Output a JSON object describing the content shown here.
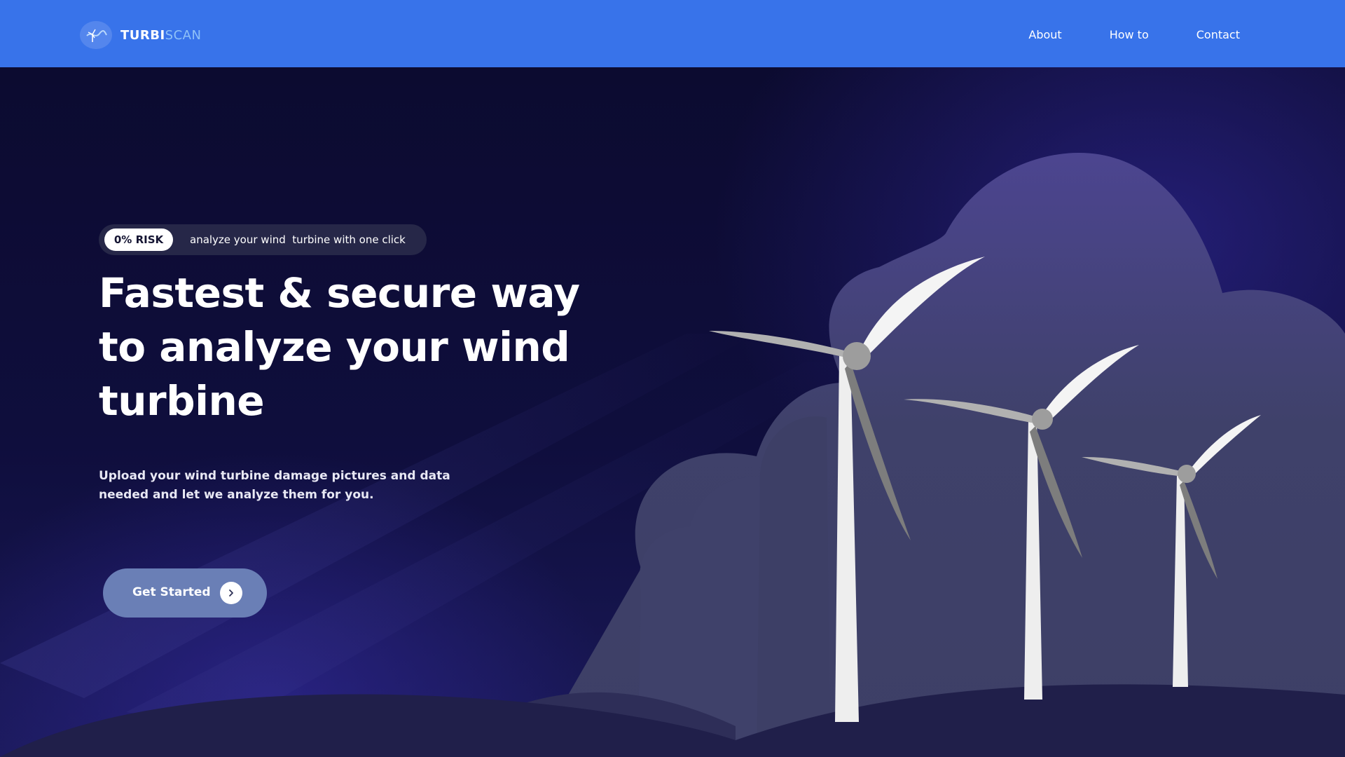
{
  "header": {
    "brand_primary": "TURBI",
    "brand_secondary": "SCAN",
    "logo_icon": "wind-turbine-icon",
    "nav": [
      "About",
      "How to",
      "Contact"
    ]
  },
  "hero": {
    "badge": "0% RISK",
    "tagline": "analyze your wind  turbine with one click",
    "title": "Fastest & secure way to analyze your wind turbine",
    "subtitle": "Upload your wind turbine damage pictures and data needed and let we analyze them for you.",
    "cta_label": "Get Started",
    "cta_icon": "chevron-right-icon"
  },
  "colors": {
    "header_bg": "#3873ea",
    "hero_bg": "#0d0c32",
    "cloud": "#3c3f68",
    "hill": "#201f4a",
    "cta_bg": "#6a7fb6",
    "turbine": "#eeeeee"
  }
}
